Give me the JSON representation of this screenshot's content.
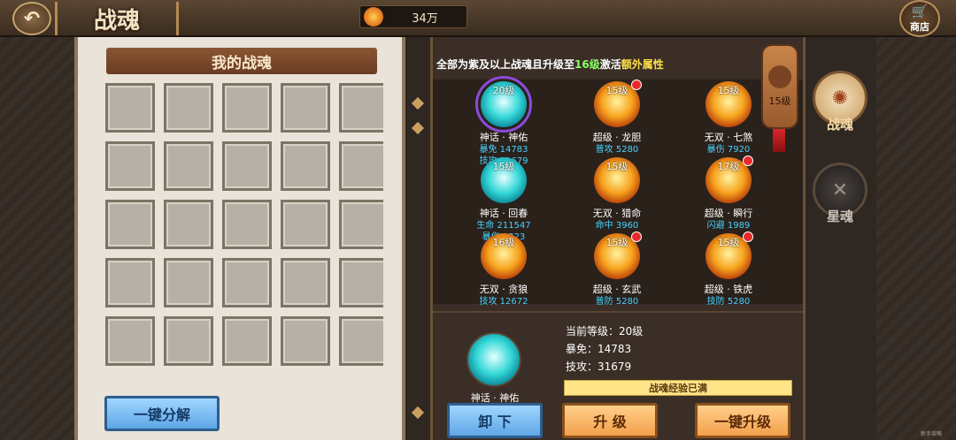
{
  "header": {
    "back_icon": "back-arrow-icon",
    "title": "战魂",
    "currency_amount": "34万",
    "shop_label": "商店"
  },
  "left_panel": {
    "title": "我的战魂",
    "slot_count": 25,
    "decompose_button": "一键分解"
  },
  "right_panel": {
    "info_prefix": "全部为紫及以上战魂且升级至",
    "info_level": "16级",
    "info_mid": "激活",
    "info_bonus": "额外属性",
    "hang_tag_level": "15级",
    "souls": [
      {
        "level": "20级",
        "name": "神话 · 神佑",
        "attrs": [
          "暴免 14783",
          "技攻 31679"
        ],
        "color": "cyan",
        "selected": true,
        "badge": false
      },
      {
        "level": "15级",
        "name": "超级 · 龙胆",
        "attrs": [
          "普攻 5280"
        ],
        "color": "orange",
        "selected": false,
        "badge": true
      },
      {
        "level": "15级",
        "name": "无双 · 七煞",
        "attrs": [
          "暴伤 7920"
        ],
        "color": "orange",
        "selected": false,
        "badge": false
      },
      {
        "level": "15级",
        "name": "神话 · 回春",
        "attrs": [
          "生命 211547",
          "暴伤 3223"
        ],
        "color": "cyan",
        "selected": false,
        "badge": false
      },
      {
        "level": "15级",
        "name": "无双 · 猎命",
        "attrs": [
          "命中 3960"
        ],
        "color": "orange",
        "selected": false,
        "badge": false
      },
      {
        "level": "17级",
        "name": "超级 · 瞬行",
        "attrs": [
          "闪避 1989"
        ],
        "color": "orange",
        "selected": false,
        "badge": true
      },
      {
        "level": "16级",
        "name": "无双 · 贪狼",
        "attrs": [
          "技攻 12672"
        ],
        "color": "orange",
        "selected": false,
        "badge": false
      },
      {
        "level": "15级",
        "name": "超级 · 玄武",
        "attrs": [
          "普防 5280"
        ],
        "color": "orange",
        "selected": false,
        "badge": true
      },
      {
        "level": "15级",
        "name": "超级 · 铁虎",
        "attrs": [
          "技防 5280"
        ],
        "color": "orange",
        "selected": false,
        "badge": true
      }
    ],
    "detail": {
      "name": "神话 · 神佑",
      "current_level": "当前等级：20级",
      "stat1": "暴免：14783",
      "stat2": "技攻：31679",
      "exp_text": "战魂经验已满"
    },
    "buttons": {
      "unequip": "卸 下",
      "upgrade": "升 级",
      "upgrade_all": "一键升级"
    }
  },
  "nav": {
    "tab1": "战魂",
    "tab2": "星魂"
  },
  "watermark": "新手攻略"
}
